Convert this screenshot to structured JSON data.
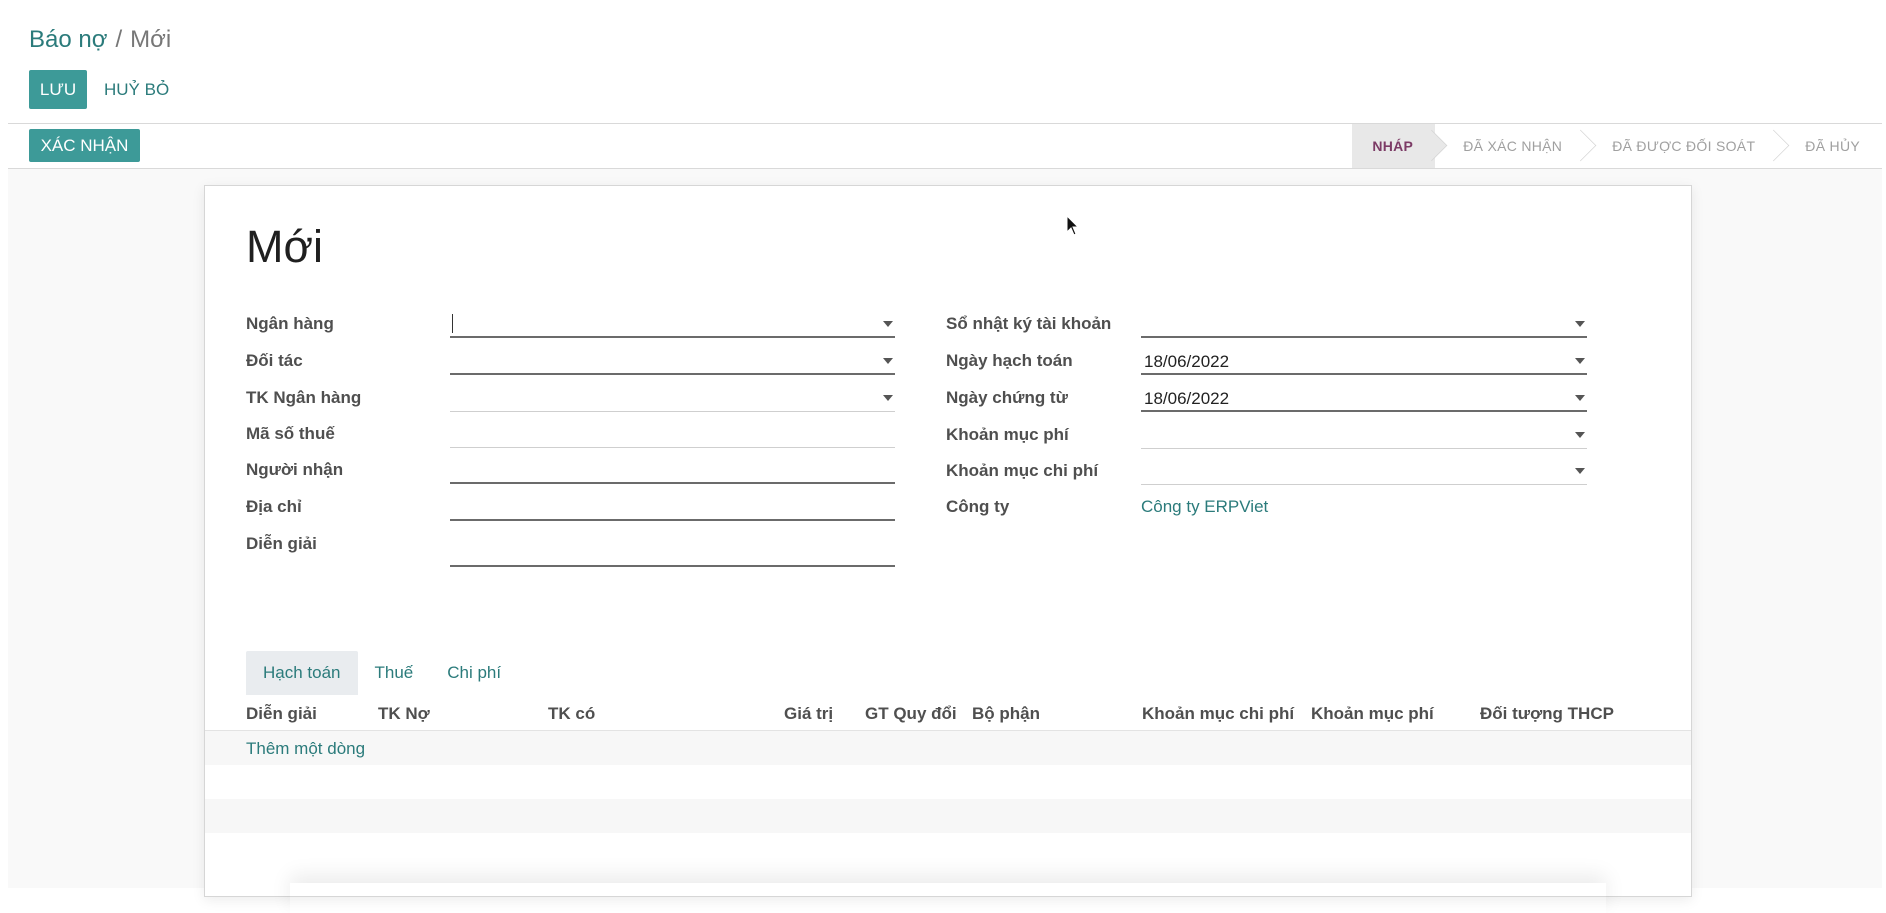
{
  "breadcrumb": {
    "parent": "Báo nợ",
    "separator": "/",
    "current": "Mới"
  },
  "toolbar": {
    "save_label": "LƯU",
    "discard_label": "HUỶ BỎ",
    "confirm_label": "XÁC NHẬN"
  },
  "statusbar": {
    "steps": [
      "NHÁP",
      "ĐÃ XÁC NHẬN",
      "ĐÃ ĐƯỢC ĐỐI SOÁT",
      "ĐÃ HỦY"
    ],
    "active_index": 0
  },
  "form": {
    "title": "Mới",
    "left": [
      {
        "label": "Ngân hàng",
        "value": "",
        "type": "select"
      },
      {
        "label": "Đối tác",
        "value": "",
        "type": "select"
      },
      {
        "label": "TK Ngân hàng",
        "value": "",
        "type": "select"
      },
      {
        "label": "Mã số thuế",
        "value": "",
        "type": "text"
      },
      {
        "label": "Người nhận",
        "value": "",
        "type": "text"
      },
      {
        "label": "Địa chỉ",
        "value": "",
        "type": "text"
      },
      {
        "label": "Diễn giải",
        "value": "",
        "type": "textarea"
      }
    ],
    "right": [
      {
        "label": "Sổ nhật ký tài khoản",
        "value": "",
        "type": "select"
      },
      {
        "label": "Ngày hạch toán",
        "value": "18/06/2022",
        "type": "select"
      },
      {
        "label": "Ngày chứng từ",
        "value": "18/06/2022",
        "type": "select"
      },
      {
        "label": "Khoản mục phí",
        "value": "",
        "type": "select"
      },
      {
        "label": "Khoản mục chi phí",
        "value": "",
        "type": "select"
      },
      {
        "label": "Công ty",
        "value": "Công ty ERPViet",
        "type": "link"
      }
    ]
  },
  "tabs": [
    "Hạch toán",
    "Thuế",
    "Chi phí"
  ],
  "active_tab": "Hạch toán",
  "table": {
    "columns": [
      "Diễn giải",
      "TK Nợ",
      "TK có",
      "Giá trị",
      "GT Quy đổi",
      "Bộ phận",
      "Khoản mục chi phí",
      "Khoản mục phí",
      "Đối tượng THCP"
    ],
    "add_line_label": "Thêm một dòng"
  },
  "colors": {
    "primary": "#3d9a98",
    "link": "#2b7b7b",
    "status_active": "#7c3b66"
  }
}
